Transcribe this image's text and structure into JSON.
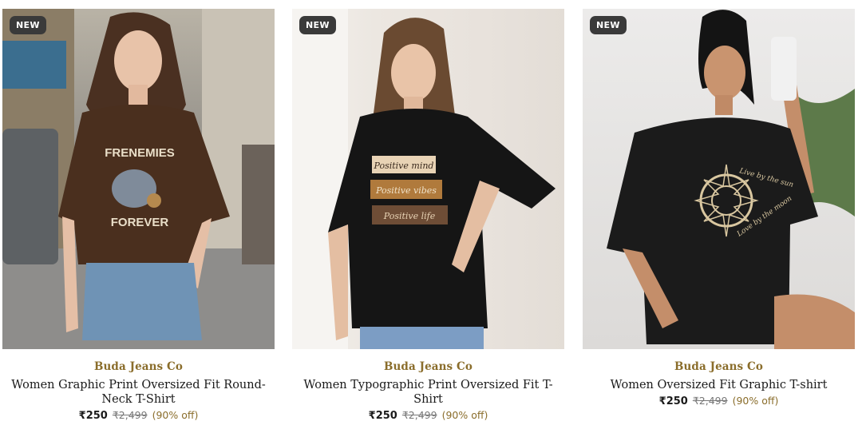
{
  "products": [
    {
      "badge": "NEW",
      "brand": "Buda Jeans Co",
      "title": "Women Graphic Print Oversized Fit Round-Neck T-Shirt",
      "price": "₹250",
      "mrp": "₹2,499",
      "discount": "(90% off)",
      "print_text": {
        "line1": "FRENEMIES",
        "line2": "FOREVER"
      },
      "colors": {
        "shirt": "#4a2f1e",
        "print": "#eadfc9"
      }
    },
    {
      "badge": "NEW",
      "brand": "Buda Jeans Co",
      "title": "Women Typographic Print Oversized Fit T-Shirt",
      "price": "₹250",
      "mrp": "₹2,499",
      "discount": "(90% off)",
      "print_text": {
        "line1": "Positive mind",
        "line2": "Positive vibes",
        "line3": "Positive life"
      },
      "colors": {
        "shirt": "#151515",
        "print": "#e8d3b5"
      }
    },
    {
      "badge": "NEW",
      "brand": "Buda Jeans Co",
      "title": "Women Oversized Fit Graphic T-shirt",
      "price": "₹250",
      "mrp": "₹2,499",
      "discount": "(90% off)",
      "print_text": {
        "line1": "Live by the sun",
        "line2": "Love by the moon"
      },
      "colors": {
        "shirt": "#1b1b1b",
        "print": "#d9c7a0"
      }
    }
  ]
}
